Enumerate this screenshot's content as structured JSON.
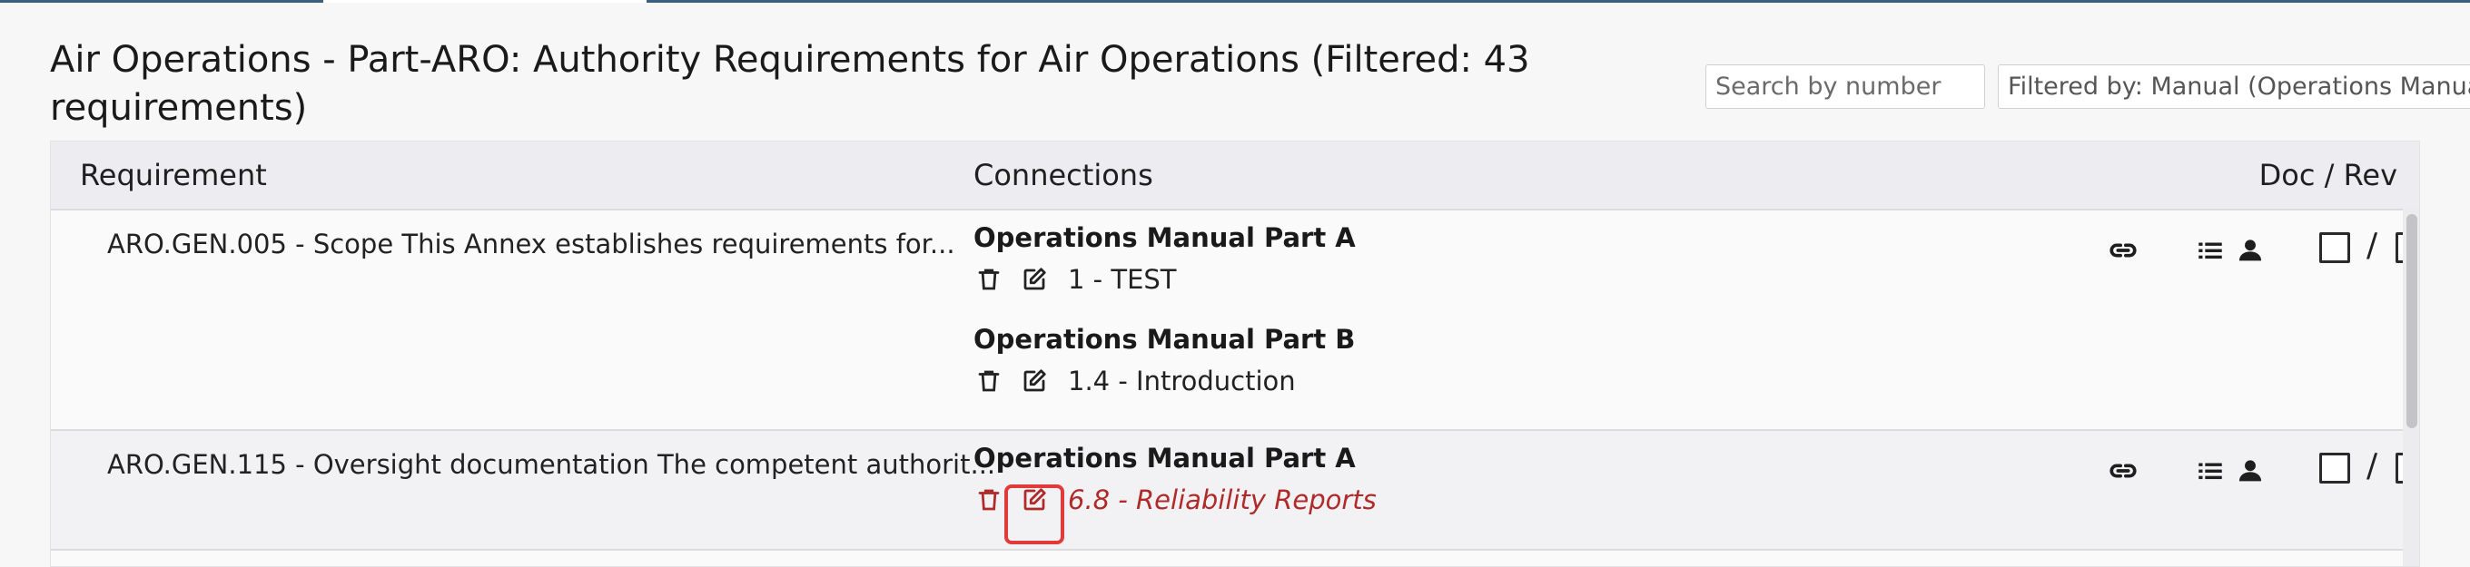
{
  "page": {
    "title": "Air Operations - Part-ARO: Authority Requirements for Air Operations (Filtered: 43 requirements)"
  },
  "search": {
    "placeholder": "Search by number"
  },
  "filter": {
    "label": "Filtered by: Manual (Operations Manual"
  },
  "table": {
    "headers": {
      "requirement": "Requirement",
      "connections": "Connections",
      "doc_rev": "Doc / Rev"
    },
    "rows": [
      {
        "requirement": "ARO.GEN.005 - Scope This Annex establishes requirements for...",
        "groups": [
          {
            "title": "Operations Manual Part A",
            "items": [
              {
                "label": "1 - TEST"
              }
            ]
          },
          {
            "title": "Operations Manual Part B",
            "items": [
              {
                "label": "1.4 - Introduction"
              }
            ]
          }
        ],
        "doc_rev_separator": "/"
      },
      {
        "requirement": "ARO.GEN.115 - Oversight documentation The competent authorit...",
        "groups": [
          {
            "title": "Operations Manual Part A",
            "items": [
              {
                "label": "6.8 - Reliability Reports",
                "highlighted": true
              }
            ]
          }
        ],
        "doc_rev_separator": "/"
      }
    ]
  },
  "icons": {
    "delete": "trash-icon",
    "edit": "edit-icon",
    "link": "link-icon",
    "list": "list-icon",
    "user": "person-icon"
  },
  "colors": {
    "accent": "#3d5f7f",
    "highlight_border": "#e03a3a",
    "highlight_text": "#b02a2a"
  }
}
